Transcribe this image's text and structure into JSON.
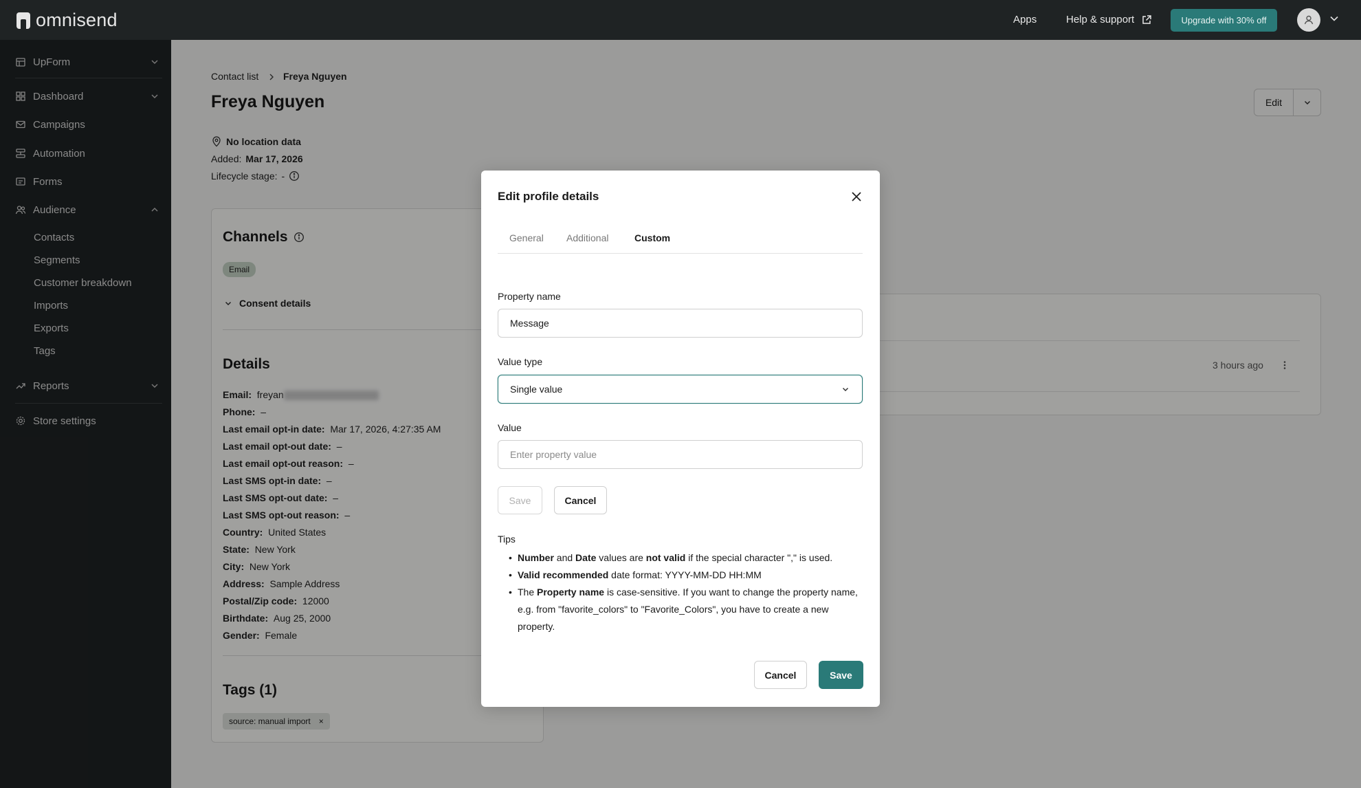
{
  "topbar": {
    "logo": "omnisend",
    "apps": "Apps",
    "help": "Help & support",
    "upgrade": "Upgrade with 30% off"
  },
  "sidebar": {
    "store": "UpForm",
    "items": [
      {
        "label": "Dashboard",
        "icon": "dashboard-icon"
      },
      {
        "label": "Campaigns",
        "icon": "mail-icon"
      },
      {
        "label": "Automation",
        "icon": "automation-icon"
      },
      {
        "label": "Forms",
        "icon": "forms-icon"
      },
      {
        "label": "Audience",
        "icon": "audience-icon"
      }
    ],
    "audience_sub": [
      "Contacts",
      "Segments",
      "Customer breakdown",
      "Imports",
      "Exports",
      "Tags"
    ],
    "reports": "Reports",
    "store_settings": "Store settings"
  },
  "breadcrumb": {
    "parent": "Contact list",
    "current": "Freya Nguyen"
  },
  "contact": {
    "name": "Freya Nguyen",
    "location": "No location data",
    "added_label": "Added:",
    "added_value": "Mar 17, 2026",
    "lifecycle_label": "Lifecycle stage:",
    "lifecycle_value": "-"
  },
  "edit_button": "Edit",
  "channels": {
    "title": "Channels",
    "email_chip": "Email",
    "consent": "Consent details"
  },
  "details": {
    "title": "Details",
    "rows": [
      {
        "k": "Email:",
        "v": "freyan"
      },
      {
        "k": "Phone:",
        "v": "–"
      },
      {
        "k": "Last email opt-in date:",
        "v": "Mar 17, 2026, 4:27:35 AM"
      },
      {
        "k": "Last email opt-out date:",
        "v": "–"
      },
      {
        "k": "Last email opt-out reason:",
        "v": "–"
      },
      {
        "k": "Last SMS opt-in date:",
        "v": "–"
      },
      {
        "k": "Last SMS opt-out date:",
        "v": "–"
      },
      {
        "k": "Last SMS opt-out reason:",
        "v": "–"
      },
      {
        "k": "Country:",
        "v": "United States"
      },
      {
        "k": "State:",
        "v": "New York"
      },
      {
        "k": "City:",
        "v": "New York"
      },
      {
        "k": "Address:",
        "v": "Sample Address"
      },
      {
        "k": "Postal/Zip code:",
        "v": "12000"
      },
      {
        "k": "Birthdate:",
        "v": "Aug 25, 2000"
      },
      {
        "k": "Gender:",
        "v": "Female"
      }
    ]
  },
  "tags": {
    "title": "Tags (1)",
    "chip": "source: manual import",
    "remove": "×"
  },
  "activity": {
    "time": "3 hours ago"
  },
  "modal": {
    "title": "Edit profile details",
    "tabs": [
      "General",
      "Additional",
      "Custom"
    ],
    "property_name_label": "Property name",
    "property_name_value": "Message",
    "value_type_label": "Value type",
    "value_type_value": "Single value",
    "value_label": "Value",
    "value_placeholder": "Enter property value",
    "inline_save": "Save",
    "inline_cancel": "Cancel",
    "tips_title": "Tips",
    "footer_cancel": "Cancel",
    "footer_save": "Save"
  }
}
